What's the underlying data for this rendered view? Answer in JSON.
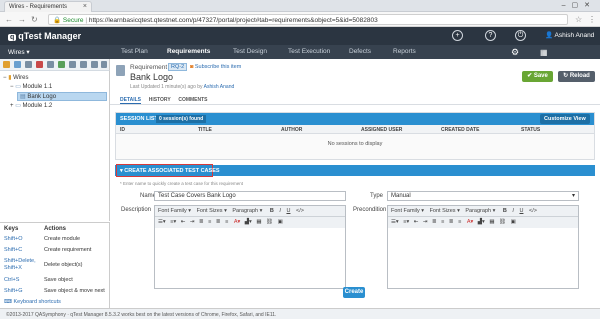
{
  "browser": {
    "tab_title": "Wires - Requirements",
    "secure_label": "Secure",
    "url": "https://learnbasicqtest.qtestnet.com/p/47327/portal/project#tab=requirements&object=5&id=5082803"
  },
  "app": {
    "logo_text": "qTest Manager",
    "user_name": "Ashish Anand",
    "project_name": "Wires"
  },
  "nav": {
    "items": [
      "Test Plan",
      "Requirements",
      "Test Design",
      "Test Execution",
      "Defects",
      "Reports"
    ],
    "active": "Requirements"
  },
  "tree": {
    "root": "Wires",
    "module1": "Module 1.1",
    "selected": "Bank Logo",
    "module2": "Module 1.2"
  },
  "shortcuts": {
    "header_keys": "Keys",
    "header_actions": "Actions",
    "rows": [
      {
        "key": "Shift+O",
        "action": "Create module"
      },
      {
        "key": "Shift+C",
        "action": "Create requirement"
      },
      {
        "key": "Shift+Delete, Shift+X",
        "action": "Delete object(s)"
      },
      {
        "key": "Ctrl+S",
        "action": "Save object"
      },
      {
        "key": "Shift+G",
        "action": "Save object & move next"
      }
    ],
    "link": "Keyboard shortcuts"
  },
  "requirement": {
    "type_label": "Requirement",
    "id_badge": "RQ-2",
    "subscribe": "Subscribe this item",
    "title": "Bank Logo",
    "updated": "Last Updated 1 minute(s) ago by",
    "updated_by": "Ashish Anand",
    "save": "Save",
    "reload": "Reload",
    "tabs": [
      "DETAILS",
      "HISTORY",
      "COMMENTS"
    ]
  },
  "sessions": {
    "title": "SESSION LIST",
    "found": "0 session(s) found",
    "customize": "Customize View",
    "columns": [
      "ID",
      "TITLE",
      "AUTHOR",
      "ASSIGNED USER",
      "CREATED DATE",
      "STATUS"
    ],
    "empty": "No sessions to display"
  },
  "create_tc": {
    "header": "CREATE ASSOCIATED TEST CASES",
    "hint": "* Enter name to quickly create a test case for this requirement",
    "name_label": "Name",
    "name_value": "Test Case Covers Bank Logo",
    "type_label": "Type",
    "type_value": "Manual",
    "description_label": "Description",
    "precondition_label": "Precondition",
    "toolbar_font_family": "Font Family",
    "toolbar_font_sizes": "Font Sizes",
    "toolbar_paragraph": "Paragraph",
    "create_button": "Create"
  },
  "footer": {
    "text": "©2013-2017 QASymphony · qTest Manager 8.5.3.2 works best on the latest versions of Chrome, Firefox, Safari, and IE11."
  }
}
